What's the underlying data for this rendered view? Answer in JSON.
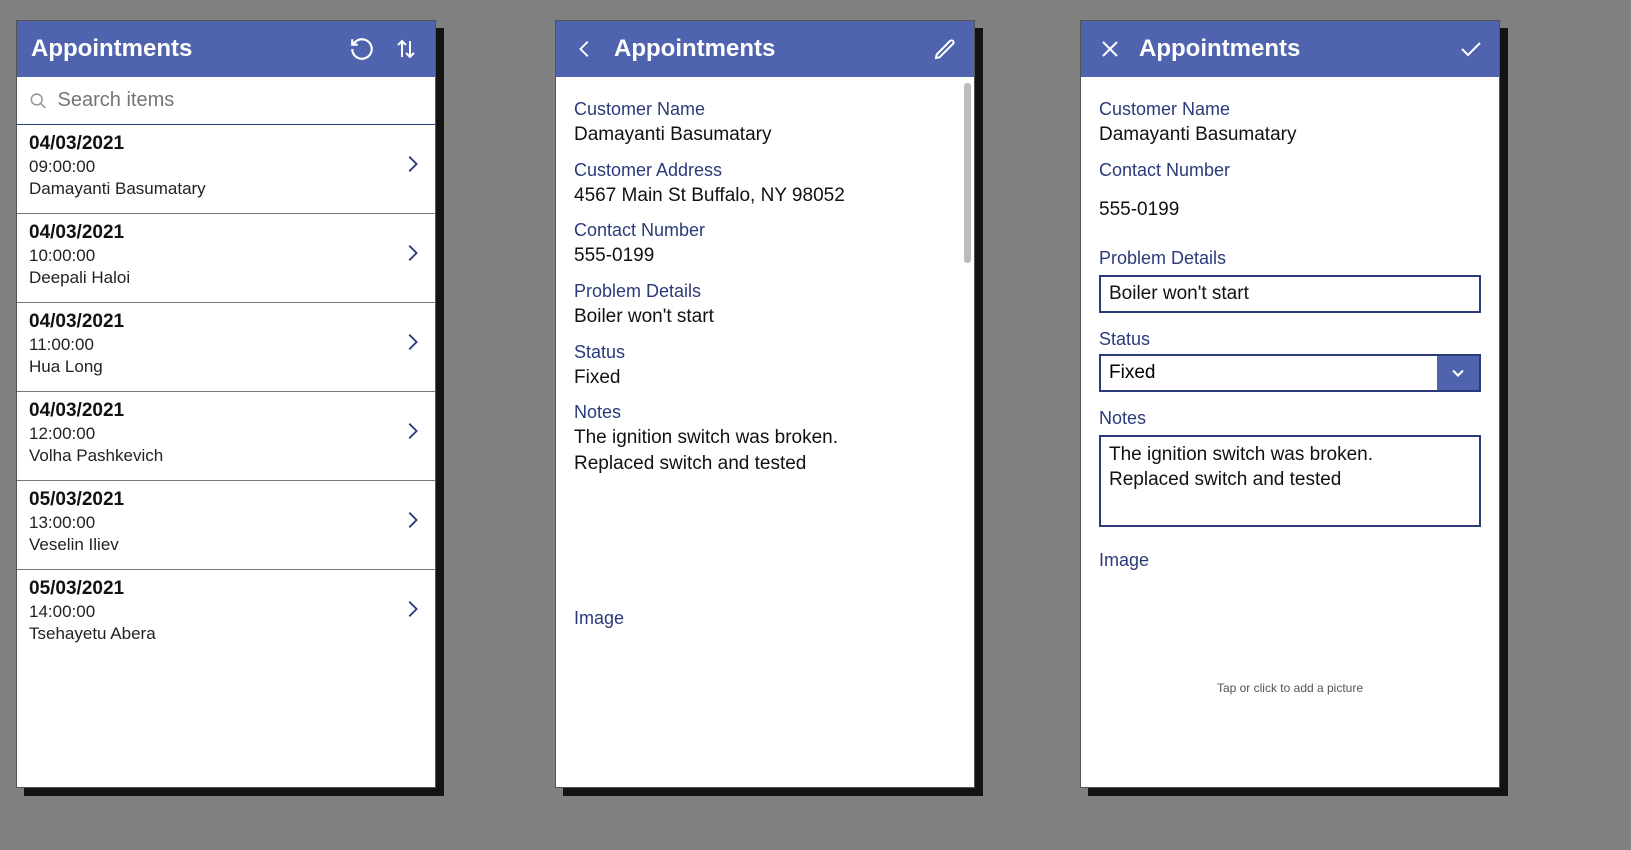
{
  "list": {
    "title": "Appointments",
    "search_placeholder": "Search items",
    "items": [
      {
        "date": "04/03/2021",
        "time": "09:00:00",
        "name": "Damayanti Basumatary"
      },
      {
        "date": "04/03/2021",
        "time": "10:00:00",
        "name": "Deepali Haloi"
      },
      {
        "date": "04/03/2021",
        "time": "11:00:00",
        "name": "Hua Long"
      },
      {
        "date": "04/03/2021",
        "time": "12:00:00",
        "name": "Volha Pashkevich"
      },
      {
        "date": "05/03/2021",
        "time": "13:00:00",
        "name": "Veselin Iliev"
      },
      {
        "date": "05/03/2021",
        "time": "14:00:00",
        "name": "Tsehayetu Abera"
      }
    ]
  },
  "detail": {
    "title": "Appointments",
    "labels": {
      "customer_name": "Customer Name",
      "customer_address": "Customer Address",
      "contact_number": "Contact Number",
      "problem_details": "Problem Details",
      "status": "Status",
      "notes": "Notes",
      "image": "Image"
    },
    "values": {
      "customer_name": "Damayanti Basumatary",
      "customer_address": "4567 Main St Buffalo, NY 98052",
      "contact_number": "555-0199",
      "problem_details": "Boiler won't start",
      "status": "Fixed",
      "notes": "The ignition switch was broken.\nReplaced switch and tested"
    }
  },
  "edit": {
    "title": "Appointments",
    "labels": {
      "customer_name": "Customer Name",
      "contact_number": "Contact Number",
      "problem_details": "Problem Details",
      "status": "Status",
      "notes": "Notes",
      "image": "Image"
    },
    "values": {
      "customer_name": "Damayanti Basumatary",
      "contact_number": "555-0199",
      "problem_details": "Boiler won't start",
      "status": "Fixed",
      "notes": "The ignition switch was broken.\nReplaced switch and tested"
    },
    "image_hint": "Tap or click to add a picture"
  }
}
